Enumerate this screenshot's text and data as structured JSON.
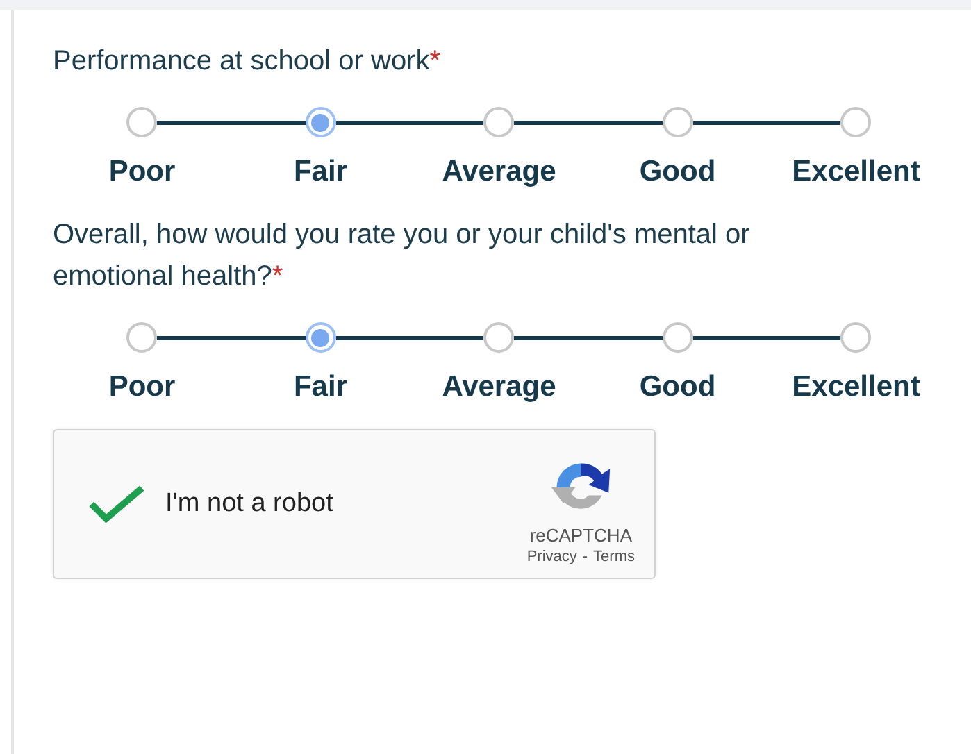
{
  "questions": [
    {
      "label": "Performance at school or work",
      "required_mark": "*",
      "options": [
        {
          "label": "Poor",
          "selected": false
        },
        {
          "label": "Fair",
          "selected": true
        },
        {
          "label": "Average",
          "selected": false
        },
        {
          "label": "Good",
          "selected": false
        },
        {
          "label": "Excellent",
          "selected": false
        }
      ]
    },
    {
      "label": "Overall, how would you rate you or your child's mental or emotional health?",
      "required_mark": "*",
      "options": [
        {
          "label": "Poor",
          "selected": false
        },
        {
          "label": "Fair",
          "selected": true
        },
        {
          "label": "Average",
          "selected": false
        },
        {
          "label": "Good",
          "selected": false
        },
        {
          "label": "Excellent",
          "selected": false
        }
      ]
    }
  ],
  "captcha": {
    "label": "I'm not a robot",
    "checked": true,
    "brand": "reCAPTCHA",
    "privacy": "Privacy",
    "separator": "-",
    "terms": "Terms"
  }
}
